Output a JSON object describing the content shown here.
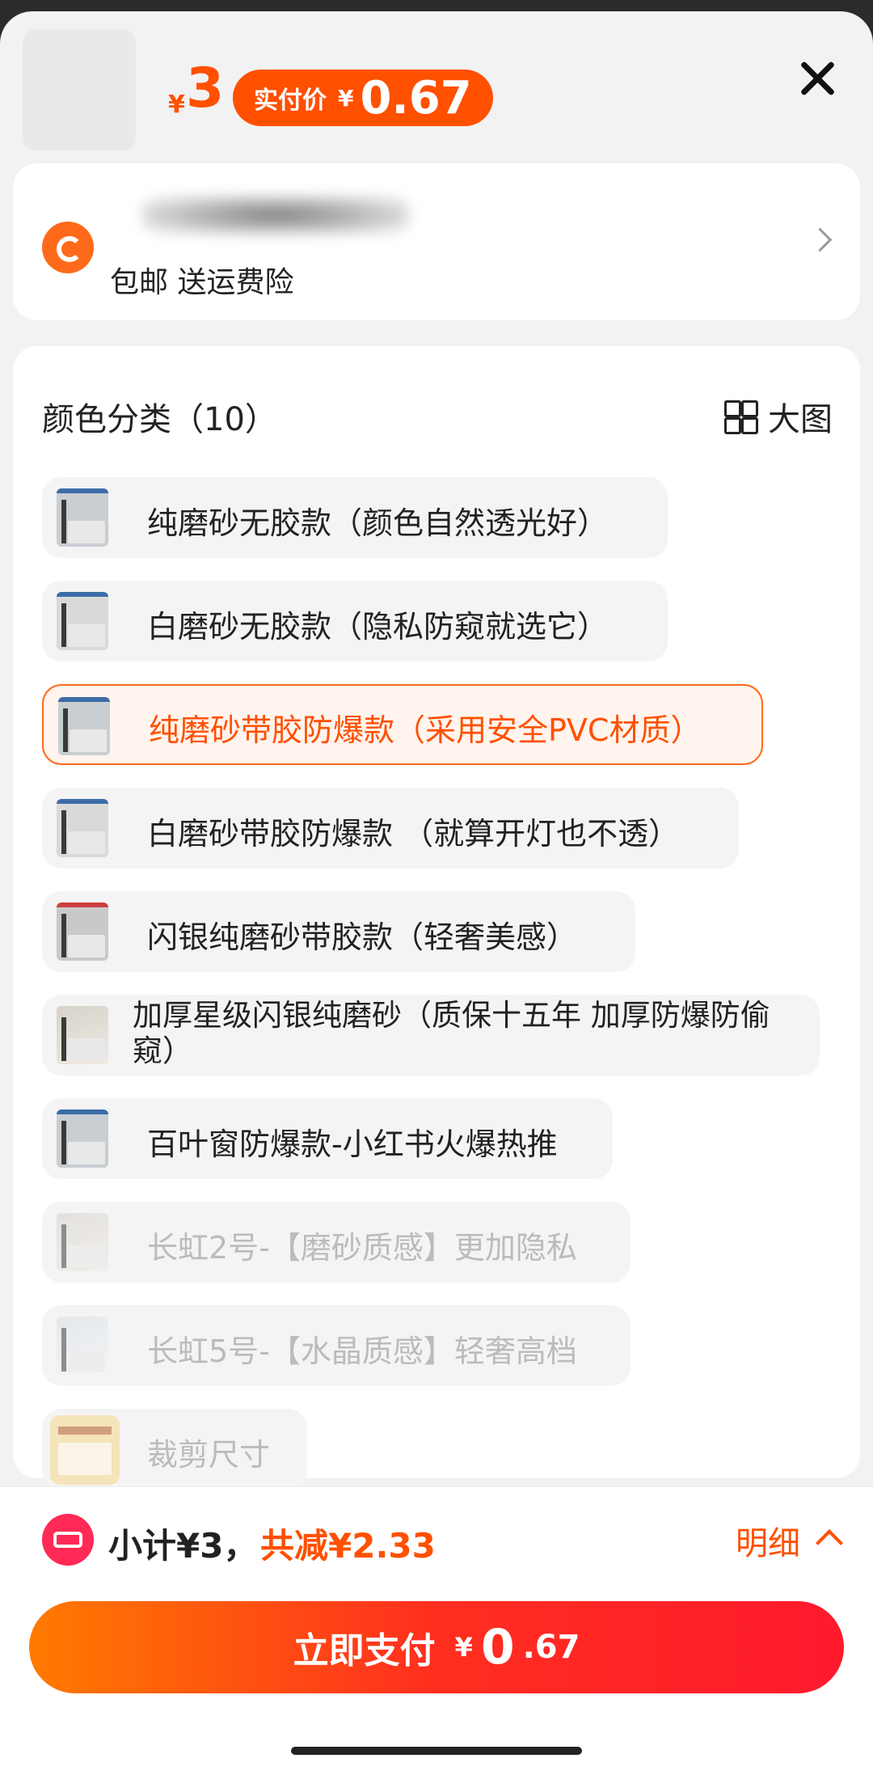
{
  "header": {
    "price_yen": "¥",
    "price": "3",
    "paid_label": "实付价",
    "paid_yen": "¥",
    "paid_amount": "0.67"
  },
  "shop": {
    "sub": "包邮 送运费险"
  },
  "variants": {
    "title": "颜色分类（10）",
    "big_view": "大图",
    "options": [
      {
        "label": "纯磨砂无胶款（颜色自然透光好）",
        "state": "normal"
      },
      {
        "label": "白磨砂无胶款（隐私防窥就选它）",
        "state": "normal"
      },
      {
        "label": "纯磨砂带胶防爆款（采用安全PVC材质）",
        "state": "selected"
      },
      {
        "label": "白磨砂带胶防爆款 （就算开灯也不透）",
        "state": "normal"
      },
      {
        "label": "闪银纯磨砂带胶款（轻奢美感）",
        "state": "normal"
      },
      {
        "label": "加厚星级闪银纯磨砂（质保十五年 加厚防爆防偷窥）",
        "state": "normal"
      },
      {
        "label": "百叶窗防爆款-小红书火爆热推",
        "state": "normal"
      },
      {
        "label": "长虹2号-【磨砂质感】更加隐私",
        "state": "disabled"
      },
      {
        "label": "长虹5号-【水晶质感】轻奢高档",
        "state": "disabled"
      },
      {
        "label": "裁剪尺寸",
        "state": "disabled"
      }
    ]
  },
  "summary": {
    "subtotal": "小计¥3，",
    "discount": "共减¥2.33",
    "detail": "明细"
  },
  "pay": {
    "label": "立即支付",
    "yen": "¥",
    "int": "0",
    "dec": ".67"
  },
  "colors": {
    "accent": "#ff5000",
    "selected_bg": "#fff4ee"
  }
}
